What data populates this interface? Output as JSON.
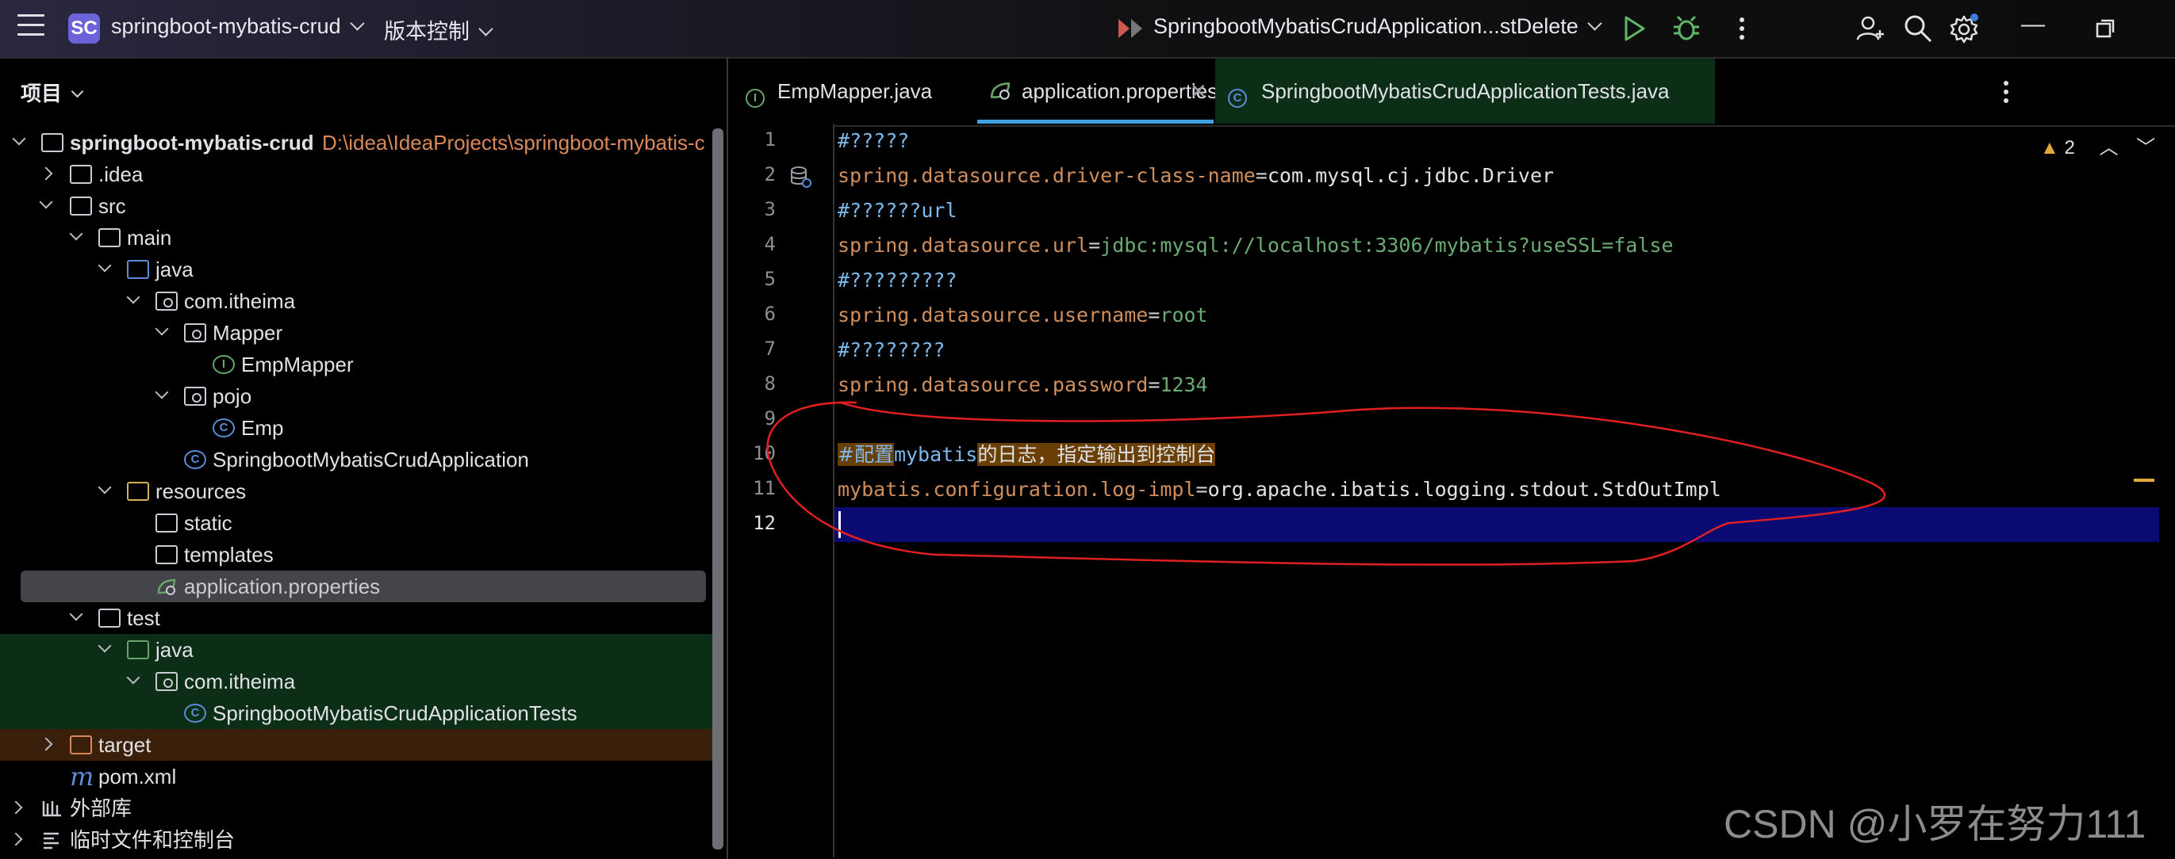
{
  "titlebar": {
    "project_badge": "SC",
    "project_name": "springboot-mybatis-crud",
    "vcs": "版本控制",
    "run_config": "SpringbootMybatisCrudApplication...stDelete"
  },
  "project_panel": {
    "header": "项目",
    "root": "springboot-mybatis-crud",
    "root_path": "D:\\idea\\IdeaProjects\\springboot-mybatis-c",
    "items": [
      {
        "label": ".idea"
      },
      {
        "label": "src"
      },
      {
        "label": "main"
      },
      {
        "label": "java"
      },
      {
        "label": "com.itheima"
      },
      {
        "label": "Mapper"
      },
      {
        "label": "EmpMapper"
      },
      {
        "label": "pojo"
      },
      {
        "label": "Emp"
      },
      {
        "label": "SpringbootMybatisCrudApplication"
      },
      {
        "label": "resources"
      },
      {
        "label": "static"
      },
      {
        "label": "templates"
      },
      {
        "label": "application.properties"
      },
      {
        "label": "test"
      },
      {
        "label": "java"
      },
      {
        "label": "com.itheima"
      },
      {
        "label": "SpringbootMybatisCrudApplicationTests"
      },
      {
        "label": "target"
      },
      {
        "label": "pom.xml"
      },
      {
        "label": "外部库"
      },
      {
        "label": "临时文件和控制台"
      }
    ]
  },
  "tabs": [
    {
      "label": "EmpMapper.java"
    },
    {
      "label": "application.properties"
    },
    {
      "label": "SpringbootMybatisCrudApplicationTests.java"
    }
  ],
  "editor": {
    "warnings": "2",
    "lines": [
      {
        "n": "1",
        "comment": "#?????"
      },
      {
        "n": "2",
        "key": "spring.datasource.driver-class-name",
        "value": "com.mysql.cj.jdbc.Driver"
      },
      {
        "n": "3",
        "comment": "#??????url"
      },
      {
        "n": "4",
        "key": "spring.datasource.url",
        "value": "jdbc:mysql://localhost:3306/mybatis?useSSL=false"
      },
      {
        "n": "5",
        "comment": "#?????????"
      },
      {
        "n": "6",
        "key": "spring.datasource.username",
        "value": "root"
      },
      {
        "n": "7",
        "comment": "#????????"
      },
      {
        "n": "8",
        "key": "spring.datasource.password",
        "value": "1234"
      },
      {
        "n": "9"
      },
      {
        "n": "10",
        "comment_a": "#配置",
        "comment_b": "mybatis",
        "comment_c": "的日志，指定输出到控制台"
      },
      {
        "n": "11",
        "key": "mybatis.configuration.log-impl",
        "value": "org.apache.ibatis.logging.stdout.StdOutImpl"
      },
      {
        "n": "12"
      }
    ]
  },
  "watermark": "CSDN @小罗在努力111",
  "colors": {
    "accent_tab": "#3ea1e0",
    "current_line": "#0a0a72",
    "annotation": "#e02020"
  }
}
